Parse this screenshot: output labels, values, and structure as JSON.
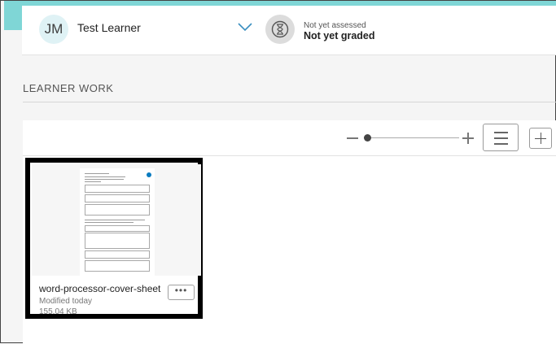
{
  "learner": {
    "initials": "JM",
    "name": "Test Learner"
  },
  "assessment": {
    "status_small": "Not yet assessed",
    "status_main": "Not yet graded"
  },
  "section": {
    "title": "LEARNER WORK"
  },
  "toolbar": {
    "zoom_level": 0.0
  },
  "files": [
    {
      "name": "word-processor-cover-sheet",
      "modified": "Modified today",
      "size": "155.04 KB",
      "more_label": "•••",
      "thumbnail_logo_color": "#0a7bc0"
    }
  ],
  "colors": {
    "accent": "#7fd6d6",
    "avatar_bg": "#dff2f5",
    "selected_border": "#000000"
  }
}
